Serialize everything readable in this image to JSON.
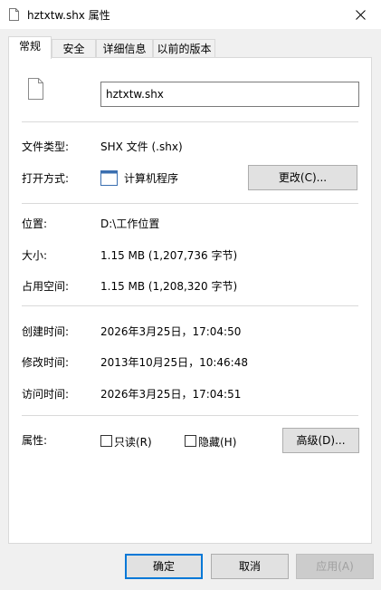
{
  "window": {
    "title": "hztxtw.shx 属性"
  },
  "tabs": [
    {
      "label": "常规"
    },
    {
      "label": "安全"
    },
    {
      "label": "详细信息"
    },
    {
      "label": "以前的版本"
    }
  ],
  "general": {
    "file_name": "hztxtw.shx",
    "type_label": "文件类型:",
    "type_value": "SHX 文件 (.shx)",
    "open_with_label": "打开方式:",
    "open_with_value": "计算机程序",
    "change_button": "更改(C)...",
    "location_label": "位置:",
    "location_value": "D:\\工作位置",
    "size_label": "大小:",
    "size_value": "1.15 MB (1,207,736 字节)",
    "disk_size_label": "占用空间:",
    "disk_size_value": "1.15 MB (1,208,320 字节)",
    "created_label": "创建时间:",
    "created_value": "2026年3月25日，17:04:50",
    "modified_label": "修改时间:",
    "modified_value": "2013年10月25日，10:46:48",
    "accessed_label": "访问时间:",
    "accessed_value": "2026年3月25日，17:04:51",
    "attributes_label": "属性:",
    "readonly_label": "只读(R)",
    "hidden_label": "隐藏(H)",
    "advanced_button": "高级(D)..."
  },
  "footer": {
    "ok": "确定",
    "cancel": "取消",
    "apply": "应用(A)"
  },
  "colors": {
    "accent": "#0078d7",
    "disabled_text": "#a0a0a0"
  }
}
